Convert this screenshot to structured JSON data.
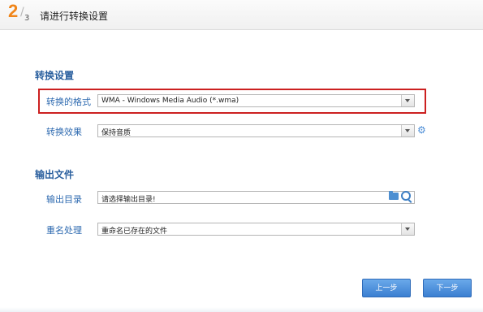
{
  "header": {
    "step_current": "2",
    "step_total": "3",
    "title": "请进行转换设置"
  },
  "sections": {
    "conversion_title": "转换设置",
    "output_title": "输出文件"
  },
  "format": {
    "label": "转换的格式",
    "value": "WMA - Windows Media Audio (*.wma)"
  },
  "effect": {
    "label": "转换效果",
    "value": "保持音质"
  },
  "output_dir": {
    "label": "输出目录",
    "value": "请选择输出目录!"
  },
  "rename": {
    "label": "重名处理",
    "value": "重命名已存在的文件"
  },
  "buttons": {
    "prev": "上一步",
    "next": "下一步"
  },
  "colors": {
    "step_accent": "#f08519",
    "section_title": "#2a5f9e",
    "highlight_border": "#cc2020",
    "button_blue": "#3b7fd1"
  }
}
